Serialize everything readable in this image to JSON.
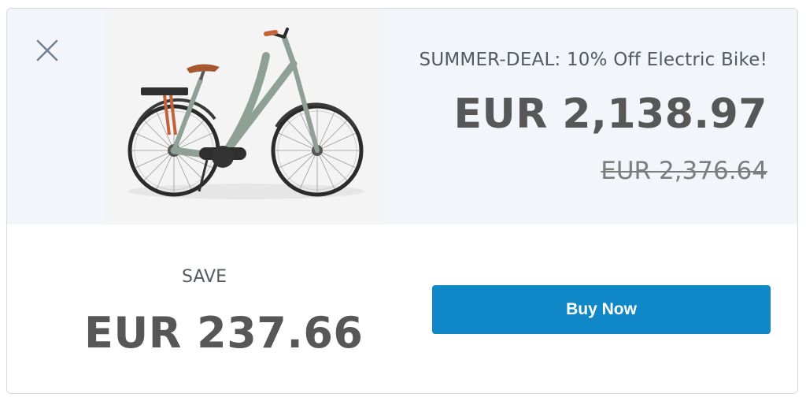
{
  "offer": {
    "title": "SUMMER-DEAL: 10% Off Electric Bike!",
    "price": "EUR 2,138.97",
    "original_price": "EUR 2,376.64",
    "save_label": "SAVE",
    "save_amount": "EUR 237.66"
  },
  "actions": {
    "buy_label": "Buy Now",
    "close_icon": "close-icon"
  },
  "colors": {
    "accent": "#1088c7",
    "panel_bg": "#f2f5f9",
    "text_dark": "#575757"
  }
}
